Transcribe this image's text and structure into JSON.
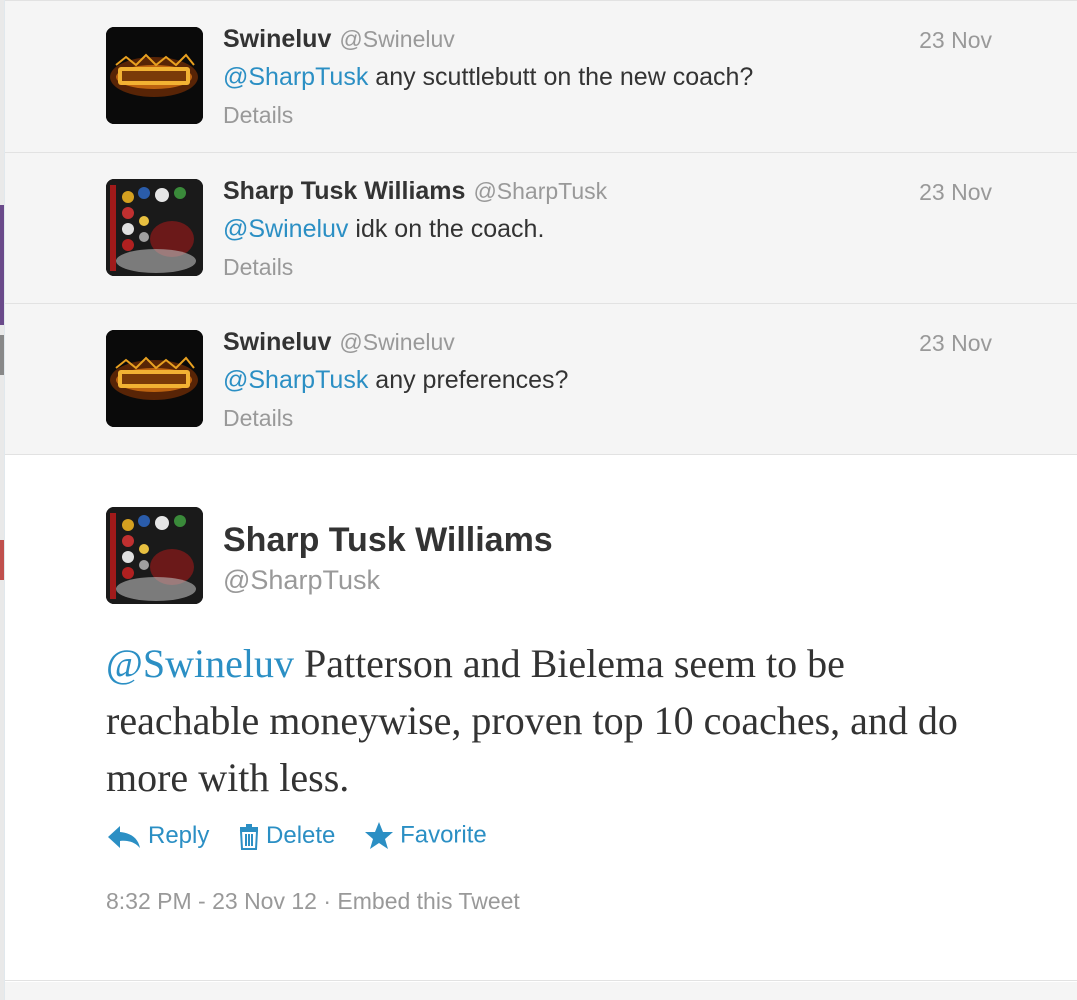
{
  "replies": [
    {
      "fullname": "Swineluv",
      "screen_name": "@Swineluv",
      "time": "23 Nov",
      "mention": "@SharpTusk",
      "text": " any scuttlebutt on the new coach?",
      "details": "Details",
      "avatar": "metallica-logo-avatar"
    },
    {
      "fullname": "Sharp Tusk Williams",
      "screen_name": "@SharpTusk",
      "time": "23 Nov",
      "mention": "@Swineluv",
      "text": " idk on the coach.",
      "details": "Details",
      "avatar": "team-logos-avatar"
    },
    {
      "fullname": "Swineluv",
      "screen_name": "@Swineluv",
      "time": "23 Nov",
      "mention": "@SharpTusk",
      "text": " any preferences?",
      "details": "Details",
      "avatar": "metallica-logo-avatar"
    }
  ],
  "main_tweet": {
    "fullname": "Sharp Tusk Williams",
    "screen_name": "@SharpTusk",
    "mention": "@Swineluv",
    "text": " Patterson and Bielema seem to be reachable moneywise, proven top 10 coaches, and do more with less.",
    "actions": {
      "reply_label": "Reply",
      "delete_label": "Delete",
      "favorite_label": "Favorite"
    },
    "timestamp": "8:32 PM - 23 Nov 12",
    "separator": " · ",
    "embed_label": "Embed this Tweet"
  },
  "colors": {
    "link": "#2b8fc4",
    "muted": "#999999",
    "text": "#333333",
    "reply_bg": "#f5f5f5"
  }
}
